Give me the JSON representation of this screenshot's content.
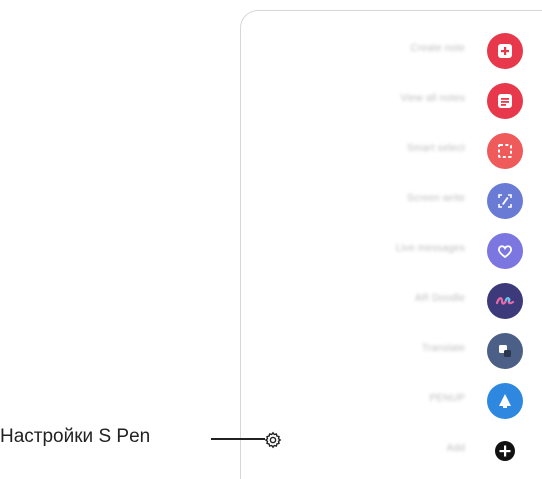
{
  "callout": {
    "label": "Настройки S Pen"
  },
  "air_command": {
    "items": [
      {
        "label": "Create note",
        "icon": "create-note-icon",
        "color": "#e8384b"
      },
      {
        "label": "View all notes",
        "icon": "view-notes-icon",
        "color": "#e8384b"
      },
      {
        "label": "Smart select",
        "icon": "smart-select-icon",
        "color": "#ef5a5a"
      },
      {
        "label": "Screen write",
        "icon": "screen-write-icon",
        "color": "#6a7bd6"
      },
      {
        "label": "Live messages",
        "icon": "live-messages-icon",
        "color": "#7b76e0"
      },
      {
        "label": "AR Doodle",
        "icon": "ar-doodle-icon",
        "color": "#3d3a7c"
      },
      {
        "label": "Translate",
        "icon": "translate-icon",
        "color": "#4c5f86"
      },
      {
        "label": "PENUP",
        "icon": "penup-icon",
        "color": "#2f88e0"
      },
      {
        "label": "Add",
        "icon": "add-icon",
        "color": "#111111"
      }
    ]
  }
}
